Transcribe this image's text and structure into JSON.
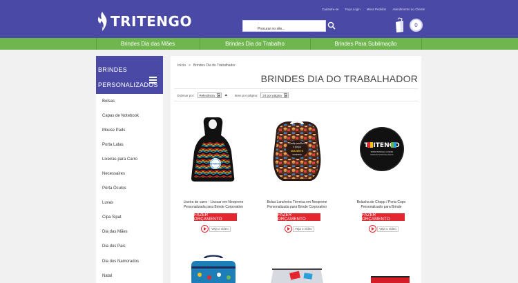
{
  "brand": {
    "name": "TRITENGO",
    "accent": "#4a4aa6",
    "green": "#6fb64f",
    "cta": "#e4262f"
  },
  "top_links": [
    "Cadastre-se",
    "Faça Login",
    "Meus Pedidos",
    "Atendimento ao Cliente"
  ],
  "search": {
    "placeholder": "Procurar no site..."
  },
  "cart": {
    "count": "0"
  },
  "nav": [
    "Brindes Dia das Mães",
    "Brindes Dia do Trabalho",
    "Brindes Para Sublimação"
  ],
  "sidebar": {
    "title": "BRINDES PERSONALIZADOS",
    "items": [
      "Bolsas",
      "Capas de Notebook",
      "Mouse Pads",
      "Porta Latas",
      "Lixeiras para Carro",
      "Necessaires",
      "Porta Óculos",
      "Luvas",
      "Cipa Sipat",
      "Dia das Mães",
      "Dia dos Pais",
      "Dia dos Namorados",
      "Natal"
    ]
  },
  "breadcrumb": {
    "home": "Início",
    "sep": ">",
    "current": "Brindes Dia do Trabalhador"
  },
  "page_title": "BRINDES DIA DO TRABALHADOR",
  "toolbar": {
    "sort_label": "Ordenar por:",
    "sort_value": "Relevância",
    "sort_dir": "▲",
    "perpage_label": "Itens por página:",
    "perpage_value": "24 por página"
  },
  "products": [
    {
      "name": "Lixeira de carro - Lixocar em Neoprene Personalizada para Brinde Corporativo",
      "button": "FAZER ORÇAMENTO",
      "video": "Veja o vídeo"
    },
    {
      "name": "Bolsa Lancheira Térmica em Neoprene Personalizada para Brinde Corporativo",
      "button": "FAZER ORÇAMENTO",
      "video": "Veja o vídeo"
    },
    {
      "name": "Bolacha de Chopp / Porta Copo Personalizado para Brinde",
      "button": "FAZER ORÇAMENTO",
      "video": "Veja o vídeo"
    }
  ],
  "product_art": {
    "lixocar_text": "MOTOR CIÓ",
    "lunch_text": [
      "Onde mulher",
      "e força",
      "MULHER E",
      "TRITENGO"
    ],
    "coaster_logo": "TRITENGO",
    "coaster_lines": [
      "WWW.TRITENGO.COM.BR",
      "BRINDES PERSONALIZADOS"
    ]
  }
}
